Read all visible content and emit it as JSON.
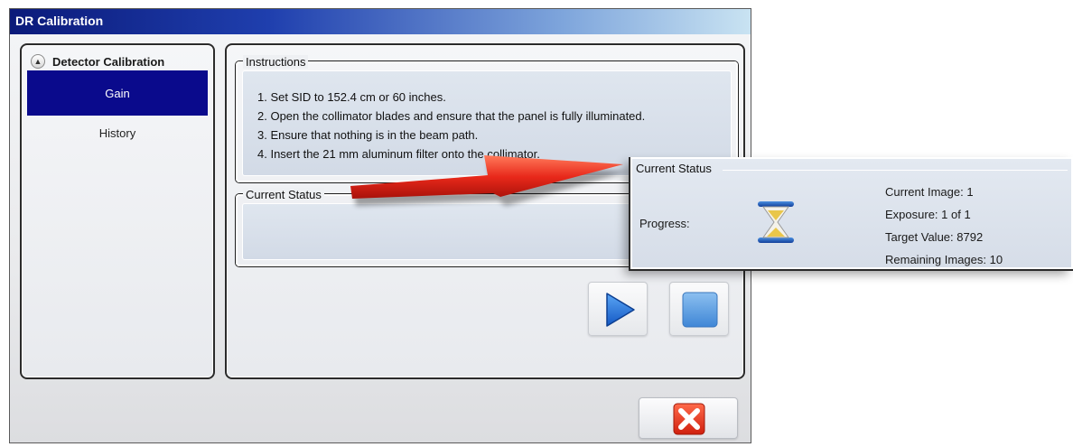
{
  "window": {
    "title": "DR Calibration"
  },
  "sidebar": {
    "header": "Detector Calibration",
    "items": [
      {
        "label": "Gain",
        "selected": true
      },
      {
        "label": "History",
        "selected": false
      }
    ]
  },
  "instructions": {
    "legend": "Instructions",
    "steps": [
      "1. Set SID to 152.4 cm or 60 inches.",
      "2. Open the collimator blades and ensure that the panel is fully illuminated.",
      "3. Ensure that nothing is in the beam path.",
      "4. Insert the 21 mm aluminum filter onto the collimator."
    ]
  },
  "status": {
    "legend": "Current Status"
  },
  "zoom": {
    "legend": "Current Status",
    "progress_label": "Progress:",
    "current_image": "Current Image:  1",
    "exposure": "Exposure:  1 of 1",
    "target_value": "Target Value:  8792",
    "remaining_images": "Remaining Images:  10"
  },
  "icons": {
    "collapse": "chevron-up-icon",
    "play": "play-icon",
    "stop": "stop-icon",
    "close": "close-icon",
    "progress": "hourglass-icon",
    "callout": "red-arrow-icon"
  },
  "colors": {
    "selected_nav": "#0a0a8c",
    "play_blue": "#1f6fd6",
    "close_red": "#e0301e",
    "arrow_red": "#e8281a"
  }
}
